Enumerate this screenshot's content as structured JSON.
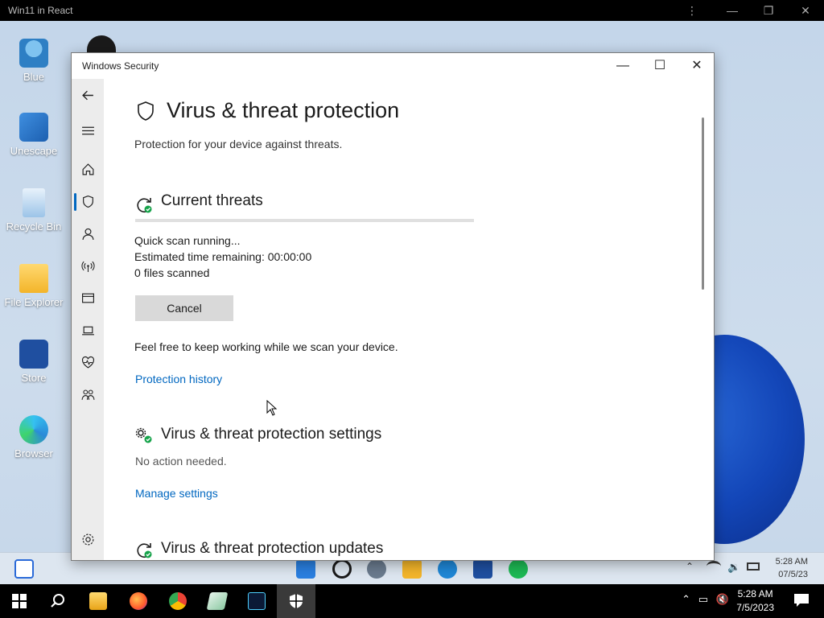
{
  "host": {
    "title": "Win11 in React",
    "controls": [
      "⋮",
      "—",
      "❐",
      "✕"
    ]
  },
  "desktop_icons": [
    {
      "label": "Blue",
      "icon": "user-icon"
    },
    {
      "label": "Unescape",
      "icon": "unescape-app-icon"
    },
    {
      "label": "Recycle Bin",
      "icon": "recycle-bin-icon"
    },
    {
      "label": "File Explorer",
      "icon": "folder-icon"
    },
    {
      "label": "Store",
      "icon": "store-icon"
    },
    {
      "label": "Browser",
      "icon": "edge-browser-icon"
    }
  ],
  "inner_taskbar": {
    "time": "5:28 AM",
    "date": "07/5/23"
  },
  "window": {
    "title": "Windows Security",
    "controls": [
      "—",
      "☐",
      "✕"
    ]
  },
  "nav_icons": [
    "back-icon",
    "menu-icon",
    "home-icon",
    "shield-icon",
    "account-icon",
    "network-icon",
    "app-browser-icon",
    "device-security-icon",
    "health-icon",
    "family-icon",
    "settings-gear-icon"
  ],
  "page": {
    "title": "Virus & threat protection",
    "subtitle": "Protection for your device against threats."
  },
  "current_threats": {
    "heading": "Current threats",
    "scan_status": "Quick scan running...",
    "time_remaining_label": "Estimated time remaining:",
    "time_remaining_value": "00:00:00",
    "files_count": "0",
    "files_label": "files scanned",
    "cancel_label": "Cancel",
    "info": "Feel free to keep working while we scan your device.",
    "history_link": "Protection history",
    "progress": 0
  },
  "settings": {
    "heading": "Virus & threat protection settings",
    "status": "No action needed.",
    "link": "Manage settings"
  },
  "updates": {
    "heading": "Virus & threat protection updates"
  },
  "clock": {
    "time": "5:28 AM",
    "date": "7/5/2023"
  },
  "colors": {
    "accent": "#0067c0",
    "check_green": "#16a34a"
  }
}
